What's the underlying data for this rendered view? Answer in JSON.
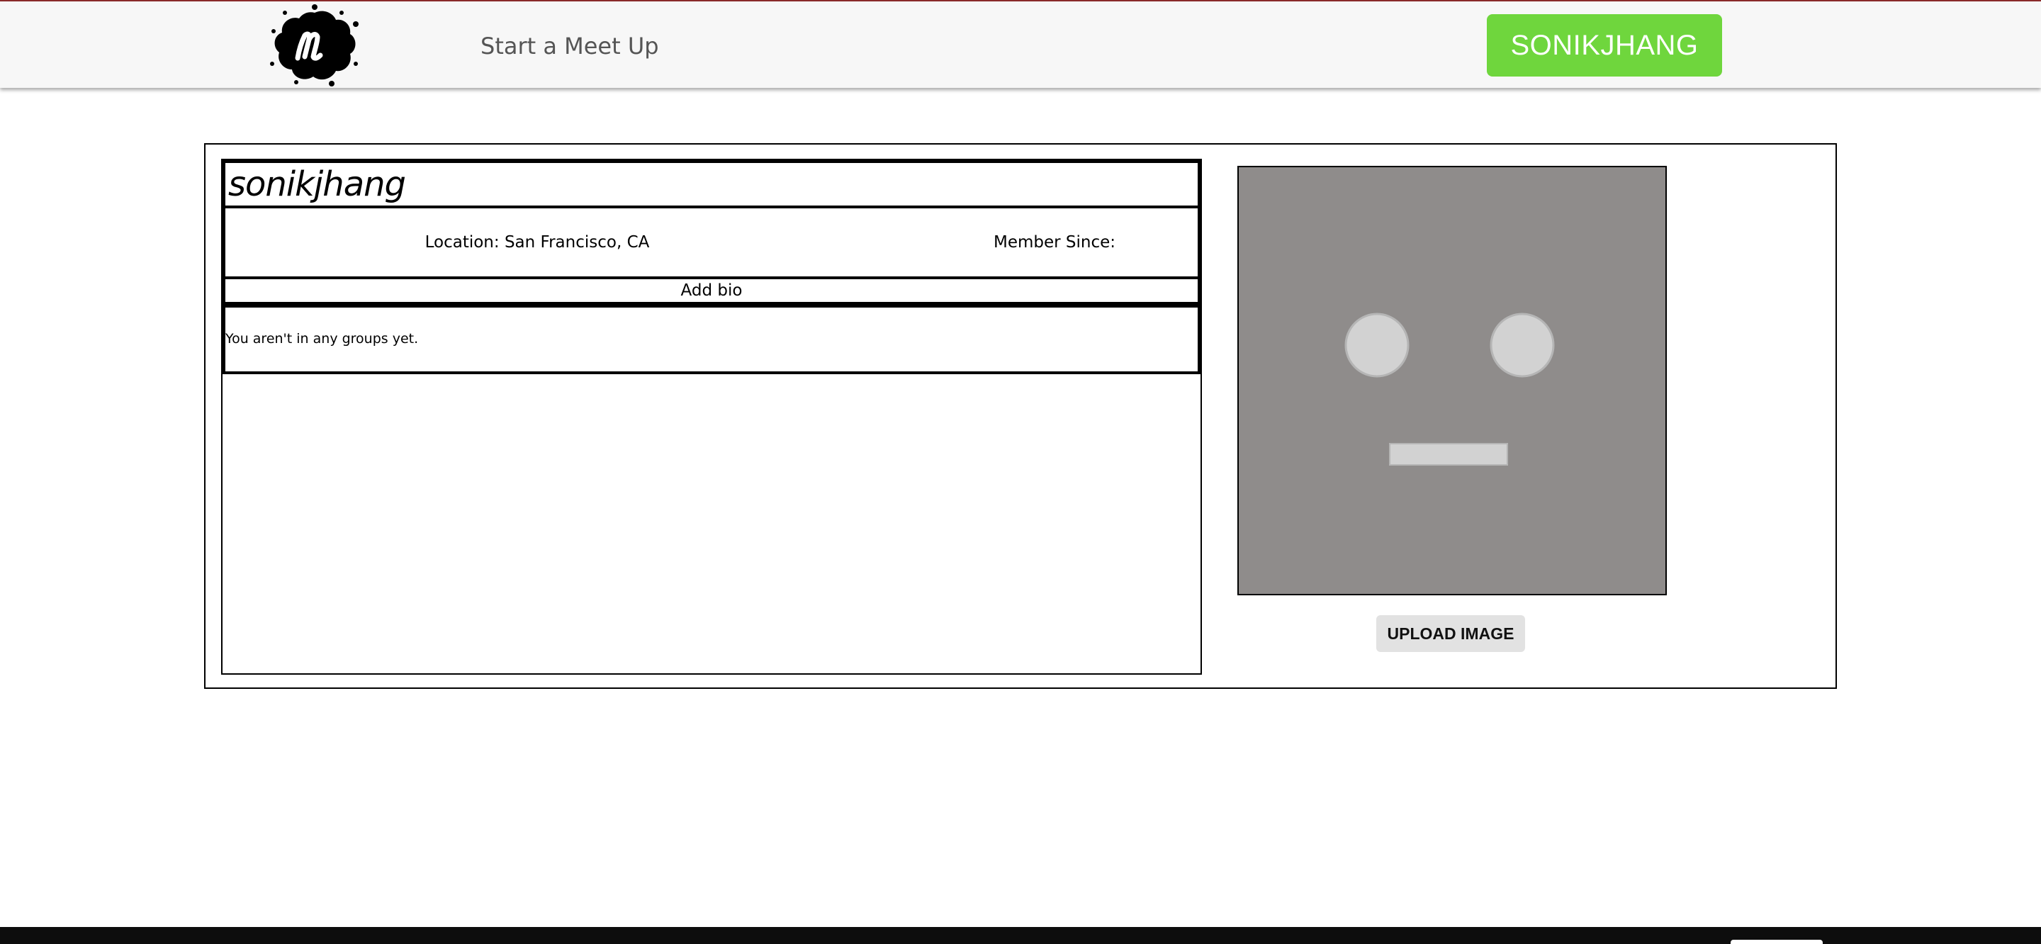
{
  "header": {
    "logo_icon": "meetup-logo-icon",
    "start_link": "Start a Meet Up",
    "user_button": "SONIKJHANG",
    "user_button_color": "#6fd63d"
  },
  "profile": {
    "username": "sonikjhang",
    "location": "Location: San Francisco, CA",
    "member_since": "Member Since:",
    "add_bio": "Add bio",
    "groups_message": "You aren't in any groups yet.",
    "avatar_icon": "default-avatar-face-icon",
    "upload_button": "UPLOAD IMAGE"
  }
}
